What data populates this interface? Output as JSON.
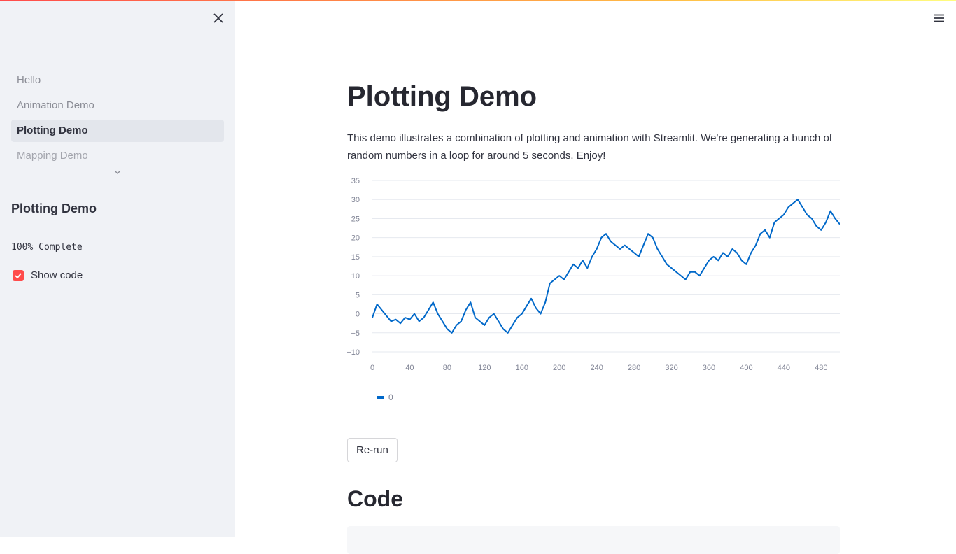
{
  "sidebar": {
    "nav": [
      {
        "label": "Hello",
        "active": false
      },
      {
        "label": "Animation Demo",
        "active": false
      },
      {
        "label": "Plotting Demo",
        "active": true
      },
      {
        "label": "Mapping Demo",
        "active": false
      }
    ],
    "title": "Plotting Demo",
    "progress_text": "100% Complete",
    "show_code": {
      "label": "Show code",
      "checked": true
    }
  },
  "main": {
    "title": "Plotting Demo",
    "description": "This demo illustrates a combination of plotting and animation with Streamlit. We're generating a bunch of random numbers in a loop for around 5 seconds. Enjoy!",
    "rerun_label": "Re-run",
    "code_heading": "Code"
  },
  "colors": {
    "accent": "#ff4b4b",
    "sidebar_bg": "#f0f2f6",
    "line": "#0068c9"
  },
  "icons": {
    "close": "close-icon",
    "menu": "hamburger-menu-icon",
    "chevron": "chevron-down-icon",
    "check": "check-icon"
  },
  "chart_data": {
    "type": "line",
    "x_ticks": [
      0,
      40,
      80,
      120,
      160,
      200,
      240,
      280,
      320,
      360,
      400,
      440,
      480
    ],
    "y_ticks": [
      -10,
      -5,
      0,
      5,
      10,
      15,
      20,
      25,
      30,
      35
    ],
    "xlim": [
      0,
      500
    ],
    "ylim": [
      -10,
      35
    ],
    "legend": [
      "0"
    ],
    "legend_position": "bottom-left",
    "grid": "horizontal",
    "series": [
      {
        "name": "0",
        "x": [
          0,
          5,
          10,
          15,
          20,
          25,
          30,
          35,
          40,
          45,
          50,
          55,
          60,
          65,
          70,
          75,
          80,
          85,
          90,
          95,
          100,
          105,
          110,
          115,
          120,
          125,
          130,
          135,
          140,
          145,
          150,
          155,
          160,
          165,
          170,
          175,
          180,
          185,
          190,
          195,
          200,
          205,
          210,
          215,
          220,
          225,
          230,
          235,
          240,
          245,
          250,
          255,
          260,
          265,
          270,
          275,
          280,
          285,
          290,
          295,
          300,
          305,
          310,
          315,
          320,
          325,
          330,
          335,
          340,
          345,
          350,
          355,
          360,
          365,
          370,
          375,
          380,
          385,
          390,
          395,
          400,
          405,
          410,
          415,
          420,
          425,
          430,
          435,
          440,
          445,
          450,
          455,
          460,
          465,
          470,
          475,
          480,
          485,
          490,
          495,
          500
        ],
        "y": [
          -1,
          2.5,
          1,
          -0.5,
          -2,
          -1.5,
          -2.5,
          -1,
          -1.5,
          0,
          -2,
          -1,
          1,
          3,
          0,
          -2,
          -4,
          -5,
          -3,
          -2,
          1,
          3,
          -1,
          -2,
          -3,
          -1,
          0,
          -2,
          -4,
          -5,
          -3,
          -1,
          0,
          2,
          4,
          1.5,
          0,
          3,
          8,
          9,
          10,
          9,
          11,
          13,
          12,
          14,
          12,
          15,
          17,
          20,
          21,
          19,
          18,
          17,
          18,
          17,
          16,
          15,
          18,
          21,
          20,
          17,
          15,
          13,
          12,
          11,
          10,
          9,
          11,
          11,
          10,
          12,
          14,
          15,
          14,
          16,
          15,
          17,
          16,
          14,
          13,
          16,
          18,
          21,
          22,
          20,
          24,
          25,
          26,
          28,
          29,
          30,
          28,
          26,
          25,
          23,
          22,
          24,
          27,
          25,
          23.5
        ]
      }
    ]
  }
}
